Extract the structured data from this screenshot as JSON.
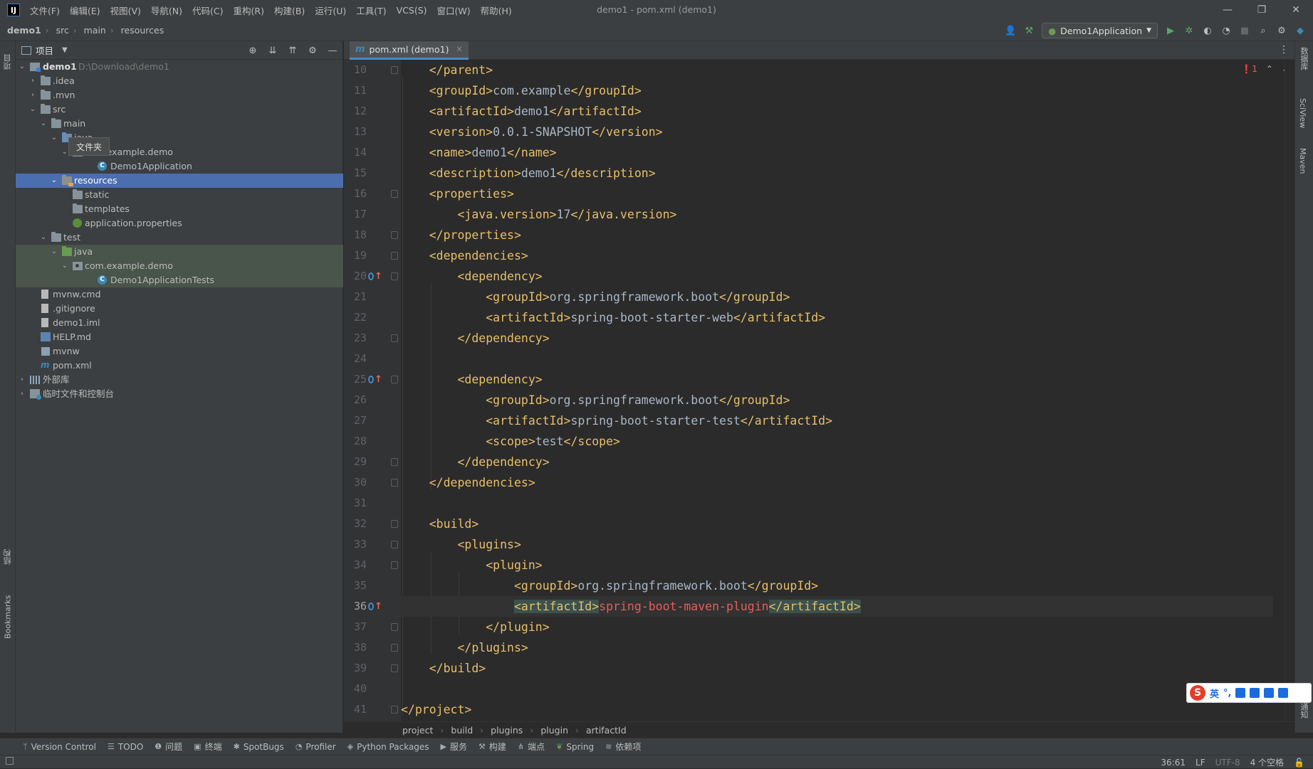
{
  "titlebar": {
    "menu": [
      "文件(F)",
      "编辑(E)",
      "视图(V)",
      "导航(N)",
      "代码(C)",
      "重构(R)",
      "构建(B)",
      "运行(U)",
      "工具(T)",
      "VCS(S)",
      "窗口(W)",
      "帮助(H)"
    ],
    "window_title": "demo1 - pom.xml (demo1)",
    "controls": [
      "—",
      "❐",
      "✕"
    ]
  },
  "navbar": {
    "crumbs": [
      "demo1",
      "src",
      "main",
      "resources"
    ],
    "run_config": "Demo1Application"
  },
  "left_strip": {
    "project": "项目",
    "structure": "结构",
    "bookmarks": "Bookmarks"
  },
  "project_panel": {
    "header_label": "项目",
    "tooltip": "文件夹",
    "tree": [
      {
        "label": "demo1",
        "hint": "D:\\Download\\demo1"
      },
      {
        "label": ".idea"
      },
      {
        "label": ".mvn"
      },
      {
        "label": "src"
      },
      {
        "label": "main"
      },
      {
        "label": "java"
      },
      {
        "label": "com.example.demo"
      },
      {
        "label": "Demo1Application"
      },
      {
        "label": "resources"
      },
      {
        "label": "static"
      },
      {
        "label": "templates"
      },
      {
        "label": "application.properties"
      },
      {
        "label": "test"
      },
      {
        "label": "java"
      },
      {
        "label": "com.example.demo"
      },
      {
        "label": "Demo1ApplicationTests"
      },
      {
        "label": "mvnw.cmd"
      },
      {
        "label": ".gitignore"
      },
      {
        "label": "demo1.iml"
      },
      {
        "label": "HELP.md"
      },
      {
        "label": "mvnw"
      },
      {
        "label": "pom.xml"
      },
      {
        "label": "外部库"
      },
      {
        "label": "临时文件和控制台"
      }
    ]
  },
  "editor": {
    "tab": "pom.xml (demo1)",
    "error_count": "1",
    "line_numbers": [
      "10",
      "11",
      "12",
      "13",
      "14",
      "15",
      "16",
      "17",
      "18",
      "19",
      "20",
      "21",
      "22",
      "23",
      "24",
      "25",
      "26",
      "27",
      "28",
      "29",
      "30",
      "31",
      "32",
      "33",
      "34",
      "35",
      "36",
      "37",
      "38",
      "39",
      "40",
      "41"
    ],
    "lines": [
      "    </parent>",
      "    <groupId>com.example</groupId>",
      "    <artifactId>demo1</artifactId>",
      "    <version>0.0.1-SNAPSHOT</version>",
      "    <name>demo1</name>",
      "    <description>demo1</description>",
      "    <properties>",
      "        <java.version>17</java.version>",
      "    </properties>",
      "    <dependencies>",
      "        <dependency>",
      "            <groupId>org.springframework.boot</groupId>",
      "            <artifactId>spring-boot-starter-web</artifactId>",
      "        </dependency>",
      "",
      "        <dependency>",
      "            <groupId>org.springframework.boot</groupId>",
      "            <artifactId>spring-boot-starter-test</artifactId>",
      "            <scope>test</scope>",
      "        </dependency>",
      "    </dependencies>",
      "",
      "    <build>",
      "        <plugins>",
      "            <plugin>",
      "                <groupId>org.springframework.boot</groupId>",
      "                <artifactId>spring-boot-maven-plugin</artifactId>",
      "            </plugin>",
      "        </plugins>",
      "    </build>",
      "",
      "</project>"
    ],
    "breadcrumb": [
      "project",
      "build",
      "plugins",
      "plugin",
      "artifactId"
    ]
  },
  "right_strip": {
    "database": "数据库",
    "sciview": "SciView",
    "maven": "Maven",
    "notifications": "通知"
  },
  "bottom_tools": [
    "Version Control",
    "TODO",
    "问题",
    "终端",
    "SpotBugs",
    "Profiler",
    "Python Packages",
    "服务",
    "构建",
    "端点",
    "Spring",
    "依赖项"
  ],
  "statusbar": {
    "position": "36:61",
    "line_sep": "LF",
    "encoding": "UTF-8",
    "indent": "4 个空格"
  },
  "ime": {
    "mode": "英",
    "punct": "°,"
  }
}
